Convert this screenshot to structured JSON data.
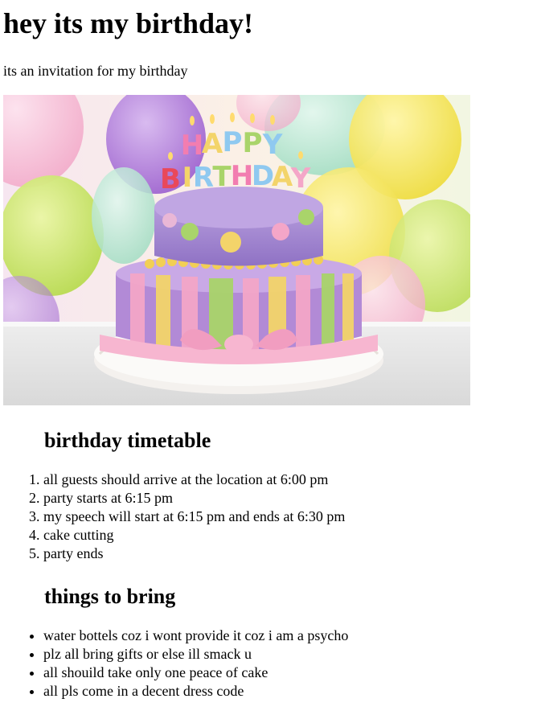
{
  "page": {
    "title": "hey its my birthday!",
    "subtitle": "its an invitation for my birthday"
  },
  "hero_image": {
    "description_icon": "birthday-cake-image",
    "topper_line1": "HAPPY",
    "topper_line2": "BIRTHDAY"
  },
  "timetable": {
    "heading": "birthday timetable",
    "items": [
      "all guests should arrive at the location at 6:00 pm",
      "party starts at 6:15 pm",
      "my speech will start at 6:15 pm and ends at 6:30 pm",
      "cake cutting",
      "party ends"
    ]
  },
  "bring": {
    "heading": "things to bring",
    "items": [
      "water bottels coz i wont provide it coz i am a psycho",
      "plz all bring gifts or else ill smack u",
      "all shouild take only one peace of cake",
      "all pls come in a decent dress code"
    ]
  },
  "colors": {
    "text": "#000000",
    "background": "#ffffff",
    "cake_top": "#a68bd0",
    "cake_bottom_stripe_pink": "#f4a6c8",
    "cake_bottom_stripe_yellow": "#f3d46a",
    "cake_bottom_stripe_green": "#a9d46a",
    "ribbon": "#f7b6d0"
  }
}
